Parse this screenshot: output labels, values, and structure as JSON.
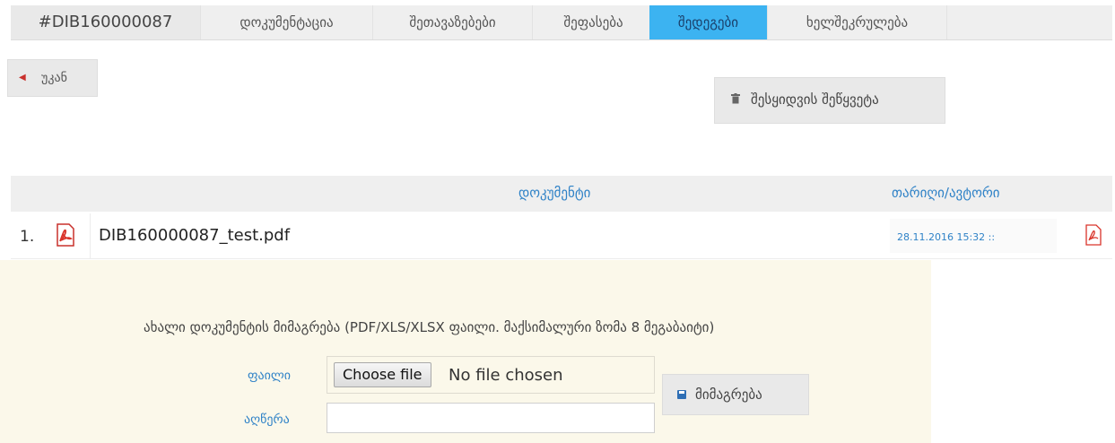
{
  "tabs": [
    {
      "label": "#DIB160000087"
    },
    {
      "label": "დოკუმენტაცია"
    },
    {
      "label": "შეთავაზებები"
    },
    {
      "label": "შეფასება"
    },
    {
      "label": "შედეგები"
    },
    {
      "label": "ხელშეკრულება"
    }
  ],
  "active_tab": "შედეგები",
  "back_button": {
    "label": "უკან",
    "icon": "chevron-left-icon"
  },
  "stop_button": {
    "label": "შესყიდვის შეწყვეტა",
    "icon": "trash-icon"
  },
  "documents_table": {
    "headers": {
      "document": "დოკუმენტი",
      "date_author": "თარიღი/ავტორი"
    },
    "rows": [
      {
        "num": "1.",
        "file_name": "DIB160000087_test.pdf",
        "date": "28.11.2016 15:32 ::"
      }
    ]
  },
  "upload": {
    "caption": "ახალი დოკუმენტის მიმაგრება (PDF/XLS/XLSX ფაილი. მაქსიმალური ზომა 8 მეგაბაიტი)",
    "file_label": "ფაილი",
    "choose_file": "Choose file",
    "no_file": "No file chosen",
    "description_label": "აღწერა",
    "description_value": "",
    "attach_button": "მიმაგრება"
  },
  "colors": {
    "active_tab": "#3cb3f1",
    "link": "#2f82c7",
    "pdf_red": "#d9342b",
    "upload_bg": "#fbf8ea"
  }
}
